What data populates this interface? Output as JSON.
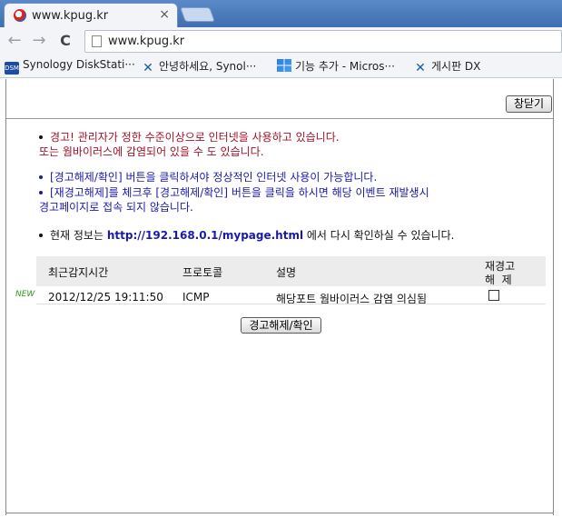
{
  "browser": {
    "tab_title": "www.kpug.kr",
    "tab_close": "×",
    "url": "www.kpug.kr",
    "back": "←",
    "forward": "→",
    "reload": "C",
    "bookmarks": [
      {
        "label": "Synology DiskStati···",
        "icon": "dsm-icon"
      },
      {
        "label": "안녕하세요, Synol···",
        "icon": "x-icon"
      },
      {
        "label": "기능 추가 - Micros···",
        "icon": "windows-icon"
      },
      {
        "label": "게시판 DX",
        "icon": "x-icon"
      }
    ]
  },
  "page": {
    "close_button": "창닫기",
    "warning_line1": "경고! 관리자가 정한 수준이상으로 인터넷을 사용하고 있습니다.",
    "warning_line2": "또는 웜바이러스에 감염되어 있을 수 도 있습니다.",
    "info_line1": "[경고해제/확인] 버튼을 클릭하셔야 정상적인 인터넷 사용이 가능합니다.",
    "info_line2": "[재경고해제]를 체크후 [경고해제/확인] 버튼을 클릭을 하시면 해당 이벤트 재발생시",
    "info_line3": "경고페이지로 접속 되지 않습니다.",
    "status_prefix": "현재 정보는 ",
    "status_link": "http://192.168.0.1/mypage.html",
    "status_suffix": " 에서 다시 확인하실 수 있습니다.",
    "table": {
      "headers": {
        "time": "최근감지시간",
        "protocol": "프로토콜",
        "desc": "설명",
        "rewarn_line1": "재경고",
        "rewarn_line2": "해  제"
      },
      "row": {
        "badge": "NEW",
        "time": "2012/12/25 19:11:50",
        "protocol": "ICMP",
        "desc": "해당포트 웜바이러스 감염 의심됨",
        "checked": false
      }
    },
    "confirm_button": "경고해제/확인"
  }
}
